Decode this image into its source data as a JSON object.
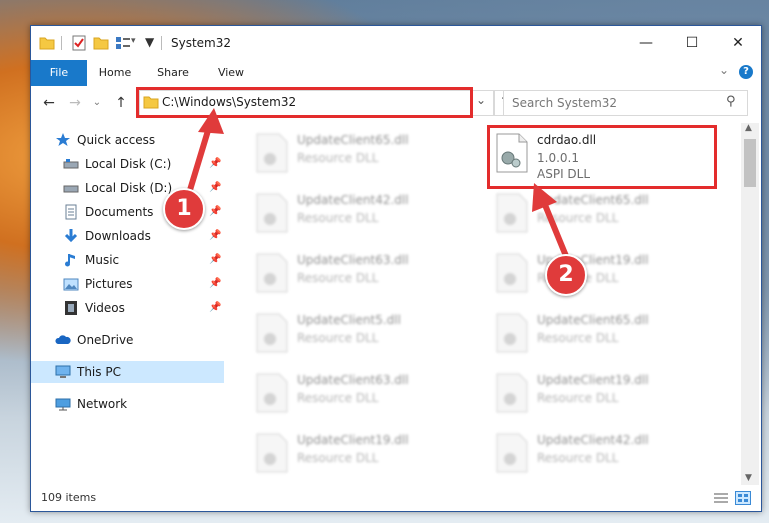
{
  "window": {
    "title": "System32",
    "controls": {
      "minimize": "—",
      "maximize": "☐",
      "close": "✕"
    }
  },
  "ribbon": {
    "tabs": [
      {
        "label": "File"
      },
      {
        "label": "Home"
      },
      {
        "label": "Share"
      },
      {
        "label": "View"
      }
    ],
    "expand_label": "⌄",
    "help_label": "?"
  },
  "navigation": {
    "back": "←",
    "forward": "→",
    "recent": "⌄",
    "up": "↑",
    "address": "C:\\Windows\\System32",
    "address_dropdown": "⌄",
    "refresh": "↻",
    "search_placeholder": "Search System32",
    "search_icon": "⚲"
  },
  "sidebar": {
    "items": [
      {
        "label": "Quick access",
        "icon": "star-icon",
        "pinned": false
      },
      {
        "label": "Local Disk (C:)",
        "icon": "drive-icon",
        "pinned": true
      },
      {
        "label": "Local Disk (D:)",
        "icon": "drive-icon",
        "pinned": true
      },
      {
        "label": "Documents",
        "icon": "document-icon",
        "pinned": true
      },
      {
        "label": "Downloads",
        "icon": "download-icon",
        "pinned": true
      },
      {
        "label": "Music",
        "icon": "music-icon",
        "pinned": true
      },
      {
        "label": "Pictures",
        "icon": "pictures-icon",
        "pinned": true
      },
      {
        "label": "Videos",
        "icon": "video-icon",
        "pinned": true
      },
      {
        "label": "OneDrive",
        "icon": "cloud-icon",
        "pinned": false
      },
      {
        "label": "This PC",
        "icon": "computer-icon",
        "pinned": false
      },
      {
        "label": "Network",
        "icon": "network-icon",
        "pinned": false
      }
    ],
    "pin_glyph": "📌"
  },
  "files": {
    "highlighted": {
      "name": "cdrdao.dll",
      "version": "1.0.0.1",
      "description": "ASPI DLL"
    },
    "column1": [
      {
        "name": "UpdateClient65.dll",
        "type": "Resource DLL"
      },
      {
        "name": "UpdateClient42.dll",
        "type": "Resource DLL"
      },
      {
        "name": "UpdateClient63.dll",
        "type": "Resource DLL"
      },
      {
        "name": "UpdateClient5.dll",
        "type": "Resource DLL"
      },
      {
        "name": "UpdateClient63.dll",
        "type": "Resource DLL"
      },
      {
        "name": "UpdateClient19.dll",
        "type": "Resource DLL"
      }
    ],
    "column2": [
      {
        "name": "UpdateClient65.dll",
        "type": "Resource DLL"
      },
      {
        "name": "UpdateClient19.dll",
        "type": "Resource DLL"
      },
      {
        "name": "UpdateClient65.dll",
        "type": "Resource DLL"
      },
      {
        "name": "UpdateClient19.dll",
        "type": "Resource DLL"
      },
      {
        "name": "UpdateClient42.dll",
        "type": "Resource DLL"
      }
    ]
  },
  "status": {
    "item_count": "109 items"
  },
  "annotations": {
    "step1": "1",
    "step2": "2",
    "color": "#e32c2c"
  }
}
